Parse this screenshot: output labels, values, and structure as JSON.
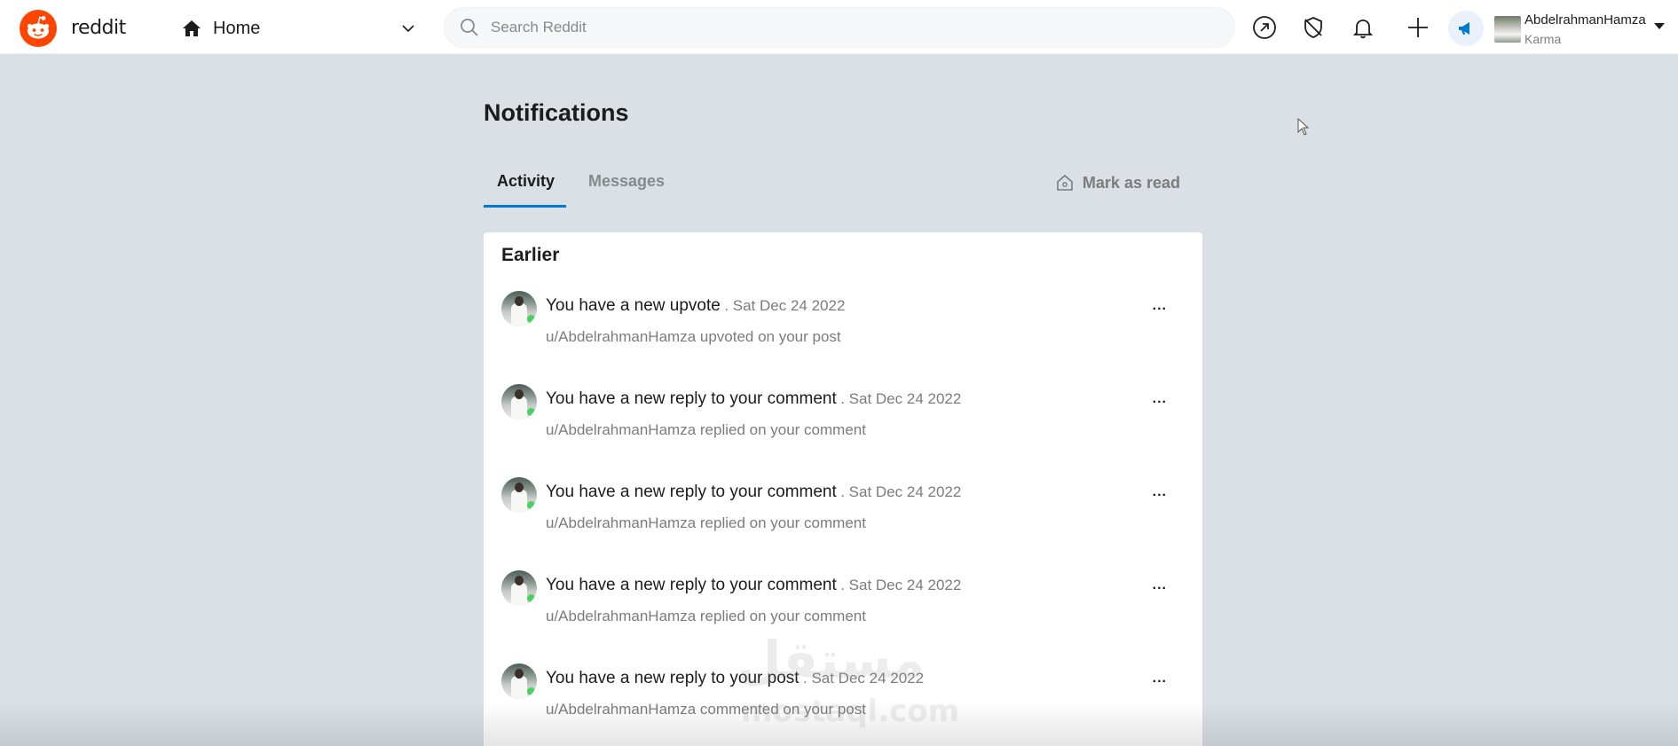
{
  "header": {
    "brand": "reddit",
    "feed_label": "Home",
    "search_placeholder": "Search Reddit",
    "username": "AbdelrahmanHamza",
    "karma_label": "Karma",
    "brand_color": "#ff4500",
    "icons": [
      "popular-icon",
      "mod-shield-icon",
      "bell-icon",
      "plus-icon",
      "megaphone-icon"
    ]
  },
  "page": {
    "title": "Notifications",
    "tabs": [
      {
        "label": "Activity",
        "active": true
      },
      {
        "label": "Messages",
        "active": false
      }
    ],
    "mark_read_label": "Mark as read",
    "accent_color": "#0079d3"
  },
  "section": {
    "title": "Earlier"
  },
  "notifications": [
    {
      "title": "You have a new upvote",
      "date": ". Sat Dec 24 2022",
      "detail": "u/AbdelrahmanHamza upvoted on your post",
      "more": "..."
    },
    {
      "title": "You have a new reply to your comment",
      "date": ". Sat Dec 24 2022",
      "detail": "u/AbdelrahmanHamza replied on your comment",
      "more": "..."
    },
    {
      "title": "You have a new reply to your comment",
      "date": ". Sat Dec 24 2022",
      "detail": "u/AbdelrahmanHamza replied on your comment",
      "more": "..."
    },
    {
      "title": "You have a new reply to your comment",
      "date": ". Sat Dec 24 2022",
      "detail": "u/AbdelrahmanHamza replied on your comment",
      "more": "..."
    },
    {
      "title": "You have a new reply to your post",
      "date": ". Sat Dec 24 2022",
      "detail": "u/AbdelrahmanHamza commented on your post",
      "more": "..."
    }
  ],
  "watermark": {
    "arabic": "مستقل",
    "latin": "mostaql.com"
  }
}
